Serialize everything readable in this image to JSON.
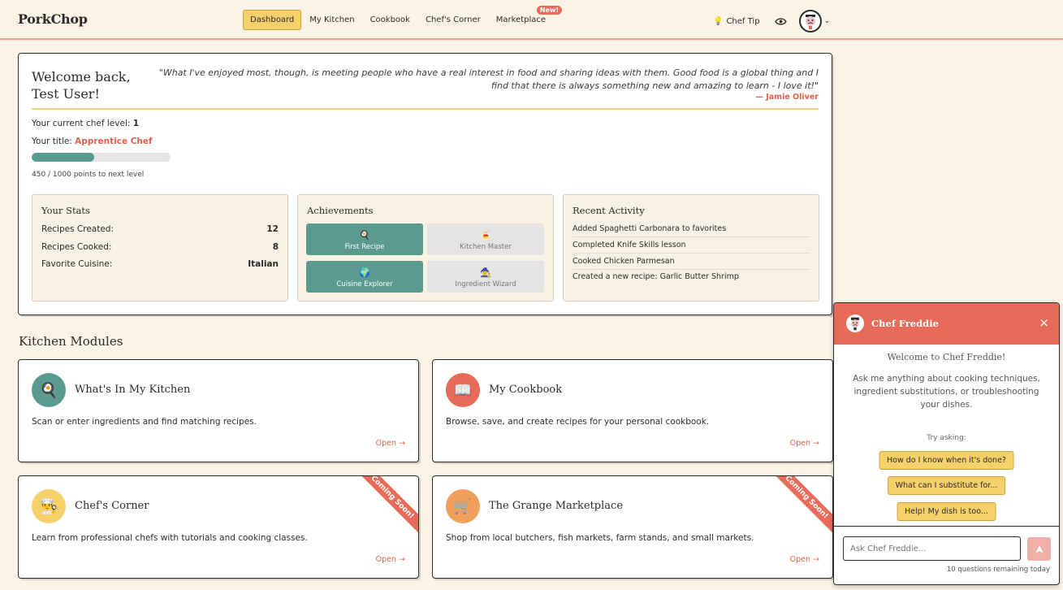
{
  "brand": "PorkChop",
  "nav": {
    "items": [
      {
        "label": "Dashboard",
        "active": true
      },
      {
        "label": "My Kitchen"
      },
      {
        "label": "Cookbook"
      },
      {
        "label": "Chef's Corner"
      },
      {
        "label": "Marketplace",
        "badge": "New!"
      }
    ],
    "chef_tip": "Chef Tip"
  },
  "welcome": {
    "title": "Welcome back, Test User!",
    "quote": "\"What I've enjoyed most, though, is meeting people who have a real interest in food and sharing ideas with them. Good food is a global thing and I find that there is always something new and amazing to learn - I love it!\"",
    "quote_author": "— Jamie Oliver",
    "level_label": "Your current chef level:",
    "level": "1",
    "title_label": "Your title:",
    "chef_title": "Apprentice Chef",
    "progress_fraction": 0.45,
    "points_text": "450 / 1000 points to next level"
  },
  "stats": {
    "title": "Your Stats",
    "rows": [
      {
        "label": "Recipes Created:",
        "value": "12"
      },
      {
        "label": "Recipes Cooked:",
        "value": "8"
      },
      {
        "label": "Favorite Cuisine:",
        "value": "Italian"
      }
    ]
  },
  "achievements": {
    "title": "Achievements",
    "items": [
      {
        "label": "First Recipe",
        "icon": "🍳",
        "unlocked": true
      },
      {
        "label": "Kitchen Master",
        "icon": "🍝",
        "unlocked": false
      },
      {
        "label": "Cuisine Explorer",
        "icon": "🌍",
        "unlocked": true
      },
      {
        "label": "Ingredient Wizard",
        "icon": "🧙",
        "unlocked": false
      }
    ]
  },
  "activity": {
    "title": "Recent Activity",
    "items": [
      "Added Spaghetti Carbonara to favorites",
      "Completed Knife Skills lesson",
      "Cooked Chicken Parmesan",
      "Created a new recipe: Garlic Butter Shrimp"
    ]
  },
  "modules": {
    "title": "Kitchen Modules",
    "items": [
      {
        "title": "What's In My Kitchen",
        "desc": "Scan or enter ingredients and find matching recipes.",
        "open": "Open →",
        "icon": "🍳",
        "color": "#5b9b8f"
      },
      {
        "title": "My Cookbook",
        "desc": "Browse, save, and create recipes for your personal cookbook.",
        "open": "Open →",
        "icon": "📖",
        "color": "#e86b5a"
      },
      {
        "title": "Chef's Corner",
        "desc": "Learn from professional chefs with tutorials and cooking classes.",
        "open": "Open →",
        "icon": "👨‍🍳",
        "color": "#f6d06b",
        "ribbon": "Coming Soon!"
      },
      {
        "title": "The Grange Marketplace",
        "desc": "Shop from local butchers, fish markets, farm stands, and small markets.",
        "open": "Open →",
        "icon": "🛒",
        "color": "#f0a05a",
        "ribbon": "Coming Soon!"
      }
    ]
  },
  "chat": {
    "name": "Chef Freddie",
    "welcome": "Welcome to Chef Freddie!",
    "intro": "Ask me anything about cooking techniques, ingredient substitutions, or troubleshooting your dishes.",
    "try_label": "Try asking:",
    "suggestions": [
      "How do I know when it's done?",
      "What can I substitute for...",
      "Help! My dish is too..."
    ],
    "placeholder": "Ask Chef Freddie...",
    "remaining": "10 questions remaining today",
    "close": "×"
  }
}
